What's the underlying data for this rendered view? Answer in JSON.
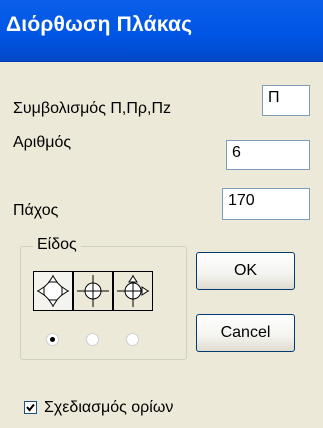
{
  "window": {
    "title": "Διόρθωση Πλάκας"
  },
  "form": {
    "symbol_label": "Συμβολισμός Π,Πρ,Πz",
    "symbol_value": "Π",
    "number_label": "Αριθμός",
    "number_value": "6",
    "thickness_label": "Πάχος",
    "thickness_value": "170"
  },
  "type_group": {
    "legend": "Είδος",
    "options": [
      {
        "icon": "slab-support-four-sides-icon",
        "selected": true
      },
      {
        "icon": "slab-support-cross-icon",
        "selected": false
      },
      {
        "icon": "slab-support-three-sides-icon",
        "selected": false
      }
    ]
  },
  "buttons": {
    "ok": "OK",
    "cancel": "Cancel"
  },
  "draw_borders": {
    "label": "Σχεδιασμός ορίων",
    "checked": true
  },
  "colors": {
    "titlebar": "#0055e5",
    "dialog_bg": "#ece9d8",
    "field_border": "#7f9db9"
  }
}
